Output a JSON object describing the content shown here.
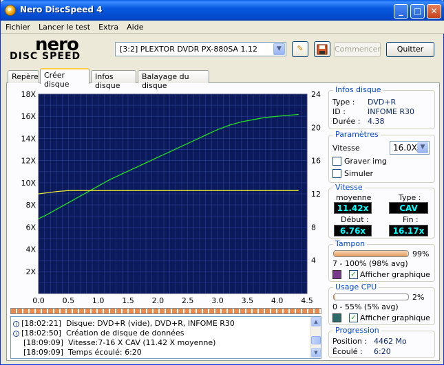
{
  "window": {
    "title": "Nero DiscSpeed 4"
  },
  "menu": [
    "Fichier",
    "Lancer le test",
    "Extra",
    "Aide"
  ],
  "logo": {
    "word1": "nero",
    "word2": "DISC SPEED"
  },
  "toolbar": {
    "drive": "[3:2]  PLEXTOR DVDR   PX-880SA 1.12",
    "start_label": "Commencer",
    "quit_label": "Quitter"
  },
  "tabs": [
    "Repère",
    "Créer disque",
    "Infos disque",
    "Balayage du disque"
  ],
  "disc_info": {
    "title": "Infos disque",
    "type_label": "Type :",
    "type": "DVD+R",
    "id_label": "ID :",
    "id": "INFOME R30",
    "duration_label": "Durée :",
    "duration": "4.38"
  },
  "params": {
    "title": "Paramètres",
    "speed_label": "Vitesse",
    "speed": "16.0X",
    "burn_label": "Graver img",
    "simulate_label": "Simuler"
  },
  "speed": {
    "title": "Vitesse",
    "avg_label": "moyenne",
    "avg": "11.42x",
    "type_label": "Type :",
    "type": "CAV",
    "start_label": "Début :",
    "start": "6.76x",
    "end_label": "Fin :",
    "end": "16.17x"
  },
  "buffer": {
    "title": "Tampon",
    "percent": "99%",
    "fill": 0.99,
    "range": "7 - 100% (98% avg)",
    "show_label": "Afficher graphique",
    "color": "#7a3a8c"
  },
  "cpu": {
    "title": "Usage CPU",
    "percent": "2%",
    "fill": 0.02,
    "range": "0 - 55% (5% avg)",
    "show_label": "Afficher graphique",
    "color": "#2f6a6a"
  },
  "progress": {
    "title": "Progression",
    "position_label": "Position :",
    "position": "4462 Mo",
    "elapsed_label": "Écoulé :",
    "elapsed": "6:20"
  },
  "log": [
    {
      "icon": true,
      "time": "[18:02:21]",
      "text": "Disque: DVD+R (vide), DVD+R, INFOME R30"
    },
    {
      "icon": true,
      "time": "[18:02:50]",
      "text": "Création de disque de données"
    },
    {
      "icon": false,
      "time": "[18:09:09]",
      "text": "Vitesse:7-16 X CAV (11.42 X moyenne)"
    },
    {
      "icon": false,
      "time": "[18:09:09]",
      "text": "Temps écoulé:  6:20"
    }
  ],
  "chart_data": {
    "type": "line",
    "x_ticks": [
      "0.0",
      "0.5",
      "1.0",
      "1.5",
      "2.0",
      "2.5",
      "3.0",
      "3.5",
      "4.0",
      "4.5"
    ],
    "y_left_ticks": [
      "2X",
      "4X",
      "6X",
      "8X",
      "10X",
      "12X",
      "14X",
      "16X",
      "18X"
    ],
    "y_right_ticks": [
      "4",
      "8",
      "12",
      "16",
      "20",
      "24"
    ],
    "xlim": [
      0,
      4.5
    ],
    "ylim_left": [
      0,
      18
    ],
    "ylim_right": [
      0,
      24
    ],
    "series": [
      {
        "color": "#22e022",
        "x": [
          0.0,
          0.1,
          0.2,
          0.3,
          0.4,
          0.5,
          0.6,
          0.7,
          0.8,
          0.9,
          1.0,
          1.2,
          1.4,
          1.6,
          1.8,
          2.0,
          2.2,
          2.4,
          2.6,
          2.8,
          3.0,
          3.2,
          3.4,
          3.6,
          3.8,
          4.0,
          4.2,
          4.35
        ],
        "values": [
          6.76,
          7.0,
          7.3,
          7.6,
          7.9,
          8.2,
          8.5,
          8.8,
          9.1,
          9.4,
          9.7,
          10.3,
          10.8,
          11.3,
          11.8,
          12.3,
          12.8,
          13.3,
          13.8,
          14.3,
          14.8,
          15.2,
          15.5,
          15.7,
          15.9,
          16.0,
          16.1,
          16.17
        ]
      },
      {
        "color": "#e8e830",
        "x": [
          0.0,
          0.3,
          0.5,
          1.0,
          1.5,
          2.0,
          2.5,
          3.0,
          3.5,
          4.0,
          4.35
        ],
        "values": [
          9.0,
          9.2,
          9.3,
          9.3,
          9.3,
          9.3,
          9.3,
          9.3,
          9.3,
          9.3,
          9.3
        ]
      }
    ]
  }
}
